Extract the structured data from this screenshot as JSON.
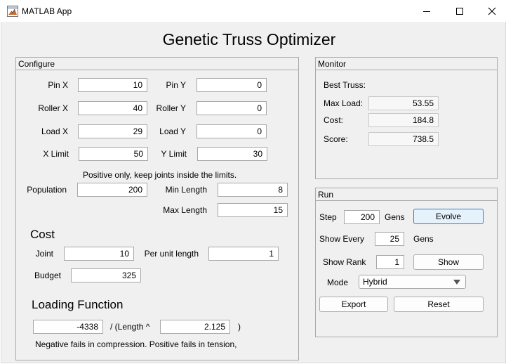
{
  "window": {
    "title": "MATLAB App"
  },
  "app": {
    "heading": "Genetic Truss Optimizer"
  },
  "configure": {
    "title": "Configure",
    "pin_x": {
      "label": "Pin X",
      "value": "10"
    },
    "pin_y": {
      "label": "Pin Y",
      "value": "0"
    },
    "roller_x": {
      "label": "Roller X",
      "value": "40"
    },
    "roller_y": {
      "label": "Roller Y",
      "value": "0"
    },
    "load_x": {
      "label": "Load X",
      "value": "29"
    },
    "load_y": {
      "label": "Load Y",
      "value": "0"
    },
    "x_limit": {
      "label": "X Limit",
      "value": "50"
    },
    "y_limit": {
      "label": "Y Limit",
      "value": "30"
    },
    "hint": "Positive only, keep joints inside the limits.",
    "population": {
      "label": "Population",
      "value": "200"
    },
    "min_length": {
      "label": "Min Length",
      "value": "8"
    },
    "max_length": {
      "label": "Max Length",
      "value": "15"
    },
    "cost_heading": "Cost",
    "joint": {
      "label": "Joint",
      "value": "10"
    },
    "per_unit_length": {
      "label": "Per unit length",
      "value": "1"
    },
    "budget": {
      "label": "Budget",
      "value": "325"
    },
    "loading_heading": "Loading Function",
    "coefficient": {
      "value": "-4338"
    },
    "length_text": "/ (Length ^",
    "exponent": {
      "value": "2.125"
    },
    "close_paren": ")",
    "note": "Negative fails in compression. Positive fails in tension,"
  },
  "monitor": {
    "title": "Monitor",
    "best_truss_label": "Best Truss:",
    "max_load": {
      "label": "Max Load:",
      "value": "53.55"
    },
    "cost": {
      "label": "Cost:",
      "value": "184.8"
    },
    "score": {
      "label": "Score:",
      "value": "738.5"
    }
  },
  "run": {
    "title": "Run",
    "step": {
      "label": "Step",
      "value": "200",
      "unit": "Gens"
    },
    "evolve_label": "Evolve",
    "show_every": {
      "label": "Show Every",
      "value": "25",
      "unit": "Gens"
    },
    "show_rank": {
      "label": "Show Rank",
      "value": "1"
    },
    "show_label": "Show",
    "mode": {
      "label": "Mode",
      "value": "Hybrid"
    },
    "export_label": "Export",
    "reset_label": "Reset"
  },
  "icons": {
    "app": "matlab-app-icon",
    "minimize": "minimize-icon",
    "maximize": "maximize-icon",
    "close": "close-icon",
    "dropdown": "chevron-down-icon"
  }
}
